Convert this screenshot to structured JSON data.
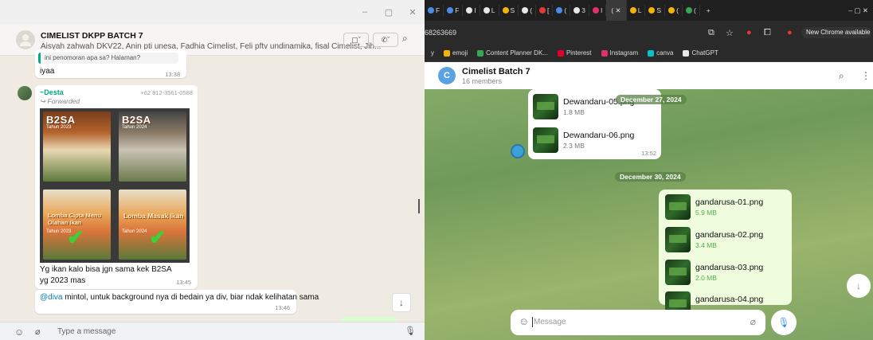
{
  "whatsapp": {
    "window_controls": [
      "–",
      "▢",
      "✕"
    ],
    "group_name": "CIMELIST DKPP BATCH 7",
    "members": "Aisyah zahwah DKV22, Anin pti unesa, Fadhia Cimelist, Feli pftv undinamika, fisal Cimelist, Jih...",
    "video_label": "▢ˇ",
    "call_label": "✆ˇ",
    "quoted_text": "ini penomoran apa sa? Halaman?",
    "msg1_text": "iyaa",
    "msg1_time": "13:38",
    "sender_name": "~Desta",
    "sender_phone": "+62 812-3561-0588",
    "forwarded": "Forwarded",
    "poster_titles": [
      "B2SA",
      "B2SA",
      "Lomba Cipta Menu Olahan Ikan",
      "Lomba Masak Ikan"
    ],
    "poster_years": [
      "Tahun 2023",
      "Tahun 2024",
      "Tahun 2023",
      "Tahun 2024"
    ],
    "caption_line1": "Yg ikan kalo bisa jgn sama kek B2SA",
    "caption_line2": "yg 2023 mas",
    "caption_time": "13:45",
    "mention": "@diva",
    "reply_text": " mintol, untuk background nya di bedain ya div, biar ndak kelihatan sama",
    "reply_time": "13:46",
    "input_placeholder": "Type a message"
  },
  "chrome": {
    "tabs": [
      {
        "label": "F",
        "color": "#4a8be8"
      },
      {
        "label": "F",
        "color": "#4a8be8"
      },
      {
        "label": "I",
        "color": "#e8e8e8"
      },
      {
        "label": "L",
        "color": "#e8e8e8"
      },
      {
        "label": "S",
        "color": "#f4b400"
      },
      {
        "label": "(",
        "color": "#e8e8e8"
      },
      {
        "label": "[",
        "color": "#e53935"
      },
      {
        "label": "(",
        "color": "#4a8be8"
      },
      {
        "label": "3",
        "color": "#e8e8e8"
      },
      {
        "label": "I",
        "color": "#e1306c"
      }
    ],
    "active_tab": "( ✕",
    "tabs_after": [
      {
        "label": "L",
        "color": "#f4b400"
      },
      {
        "label": "S",
        "color": "#f4b400"
      },
      {
        "label": "(",
        "color": "#f4b400"
      },
      {
        "label": "(",
        "color": "#34a853"
      }
    ],
    "url": "68263669",
    "new_chrome": "New Chrome available",
    "bookmarks": [
      {
        "label": "y",
        "color": ""
      },
      {
        "label": "emoji",
        "color": "#f4b400"
      },
      {
        "label": "Content Planner DK...",
        "color": "#34a853"
      },
      {
        "label": "Pinterest",
        "color": "#e60023"
      },
      {
        "label": "Instagram",
        "color": "#e1306c"
      },
      {
        "label": "canva",
        "color": "#00c4cc"
      },
      {
        "label": "ChatGPT",
        "color": "#e8e8e8"
      }
    ]
  },
  "telegram": {
    "avatar_letter": "C",
    "title": "Cimelist Batch 7",
    "members": "16 members",
    "date1": "December 27, 2024",
    "date2": "December 30, 2024",
    "files_in": [
      {
        "name": "Dewandaru-05.png",
        "size": "1.8 MB"
      },
      {
        "name": "Dewandaru-06.png",
        "size": "2.3 MB"
      }
    ],
    "files_in_time": "13:52",
    "files_out": [
      {
        "name": "gandarusa-01.png",
        "size": "5.9 MB"
      },
      {
        "name": "gandarusa-02.png",
        "size": "3.4 MB"
      },
      {
        "name": "gandarusa-03.png",
        "size": "2.0 MB"
      },
      {
        "name": "gandarusa-04.png",
        "size": ""
      }
    ],
    "input_placeholder": "Message"
  }
}
